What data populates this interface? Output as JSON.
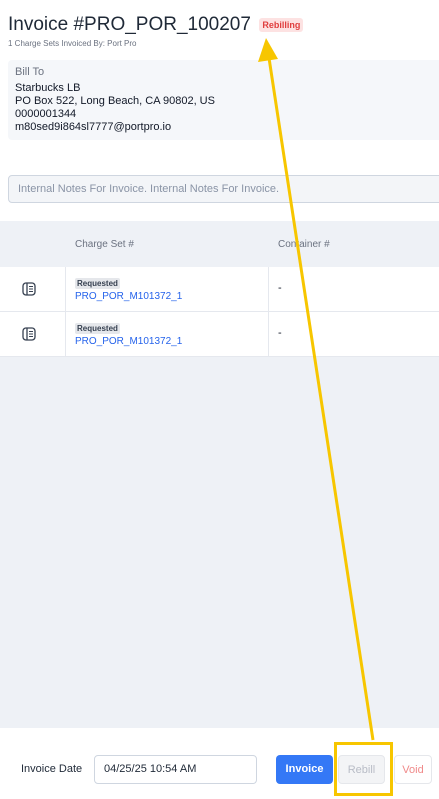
{
  "header": {
    "title": "Invoice #PRO_POR_100207",
    "status_badge": "Rebilling",
    "subtitle": "1 Charge Sets Invoiced By: Port Pro"
  },
  "bill_to": {
    "label": "Bill To",
    "name": "Starbucks LB",
    "address": "PO Box 522, Long Beach, CA 90802, US",
    "phone": "0000001344",
    "email": "m80sed9i864sl7777@portpro.io"
  },
  "notes": {
    "placeholder": "Internal Notes For Invoice. Internal Notes For Invoice."
  },
  "table": {
    "columns": [
      "Charge Set #",
      "Container #"
    ],
    "rows": [
      {
        "status": "Requested",
        "charge_set": "PRO_POR_M101372_1",
        "container": "-"
      },
      {
        "status": "Requested",
        "charge_set": "PRO_POR_M101372_1",
        "container": "-"
      }
    ]
  },
  "footer": {
    "date_label": "Invoice Date",
    "date_value": "04/25/25 10:54 AM",
    "invoice_button": "Invoice",
    "rebill_button": "Rebill",
    "void_button": "Void"
  },
  "colors": {
    "accent": "#3478f6",
    "badge_red": "#e03e3e",
    "annotation_yellow": "#f7c600"
  }
}
